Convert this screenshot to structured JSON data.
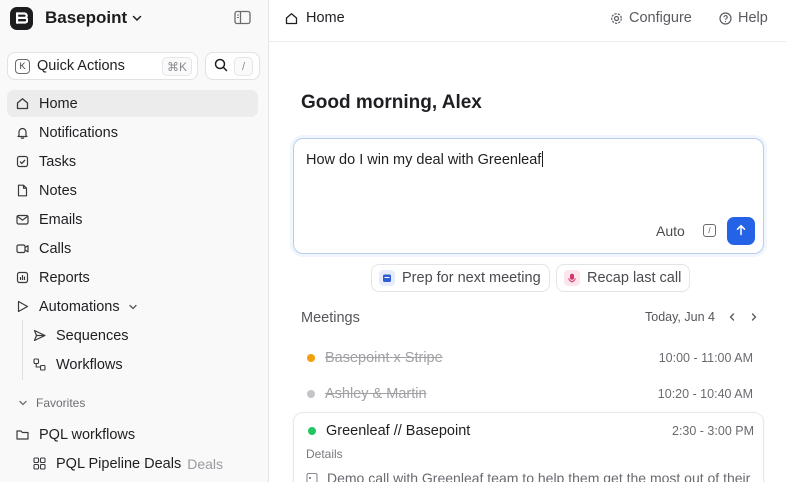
{
  "workspace": {
    "name": "Basepoint"
  },
  "quick_actions": {
    "label": "Quick Actions",
    "shortcut": "⌘K",
    "key_icon": "K",
    "search_shortcut": "/"
  },
  "nav": {
    "items": [
      {
        "label": "Home",
        "icon": "home-icon",
        "active": true
      },
      {
        "label": "Notifications",
        "icon": "bell-icon"
      },
      {
        "label": "Tasks",
        "icon": "checkbox-icon"
      },
      {
        "label": "Notes",
        "icon": "file-icon"
      },
      {
        "label": "Emails",
        "icon": "mail-icon"
      },
      {
        "label": "Calls",
        "icon": "video-icon"
      },
      {
        "label": "Reports",
        "icon": "chart-icon"
      },
      {
        "label": "Automations",
        "icon": "play-icon"
      },
      {
        "label": "Sequences",
        "icon": "send-icon"
      },
      {
        "label": "Workflows",
        "icon": "workflow-icon"
      }
    ],
    "favorites_label": "Favorites",
    "favorites": [
      {
        "label": "PQL workflows",
        "icon": "folder-icon"
      },
      {
        "label": "PQL Pipeline Deals",
        "suffix": "Deals",
        "icon": "grid-icon"
      }
    ]
  },
  "topbar": {
    "breadcrumb": "Home",
    "configure": "Configure",
    "help": "Help"
  },
  "greeting": "Good morning, Alex",
  "prompt": {
    "text": "How do I win my deal with Greenleaf",
    "mode": "Auto",
    "cmd_glyph": "/"
  },
  "chips": [
    {
      "label": "Prep for next meeting",
      "icon": "calendar-icon",
      "color": "#2f5fd3"
    },
    {
      "label": "Recap last call",
      "icon": "mic-icon",
      "color": "#d6336c"
    }
  ],
  "meetings": {
    "label": "Meetings",
    "date": "Today, Jun 4",
    "items": [
      {
        "title": "Basepoint x Stripe",
        "time": "10:00 - 11:00 AM",
        "dot": "#f59e0b",
        "done": true
      },
      {
        "title": "Ashley & Martin",
        "time": "10:20 - 10:40 AM",
        "dot": "#c4c4c8",
        "done": true
      },
      {
        "title": "Greenleaf // Basepoint",
        "time": "2:30 - 3:00 PM",
        "dot": "#22c55e",
        "done": false
      }
    ],
    "details_label": "Details",
    "details_text": "Demo call with Greenleaf team to help them get the most out of their"
  }
}
